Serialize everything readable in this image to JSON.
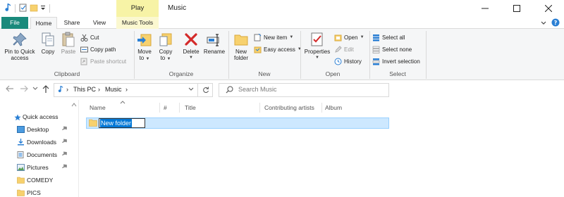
{
  "window": {
    "title": "Music",
    "context_tab_header": "Play"
  },
  "tabs": {
    "file": "File",
    "home": "Home",
    "share": "Share",
    "view": "View",
    "music_tools": "Music Tools"
  },
  "ribbon": {
    "clipboard": {
      "label": "Clipboard",
      "pin_to_quick_access_l1": "Pin to Quick",
      "pin_to_quick_access_l2": "access",
      "copy": "Copy",
      "paste": "Paste",
      "cut": "Cut",
      "copy_path": "Copy path",
      "paste_shortcut": "Paste shortcut"
    },
    "organize": {
      "label": "Organize",
      "move_to_l1": "Move",
      "move_to_l2": "to",
      "copy_to_l1": "Copy",
      "copy_to_l2": "to",
      "delete": "Delete",
      "rename": "Rename"
    },
    "new": {
      "label": "New",
      "new_folder_l1": "New",
      "new_folder_l2": "folder",
      "new_item": "New item",
      "easy_access": "Easy access"
    },
    "open": {
      "label": "Open",
      "properties": "Properties",
      "open": "Open",
      "edit": "Edit",
      "history": "History"
    },
    "select": {
      "label": "Select",
      "select_all": "Select all",
      "select_none": "Select none",
      "invert_selection": "Invert selection"
    }
  },
  "address": {
    "crumbs": [
      "This PC",
      "Music"
    ],
    "search_placeholder": "Search Music"
  },
  "nav_pane": {
    "items": [
      {
        "label": "Quick access",
        "icon": "star-icon"
      },
      {
        "label": "Desktop",
        "icon": "desktop-folder-icon"
      },
      {
        "label": "Downloads",
        "icon": "downloads-folder-icon"
      },
      {
        "label": "Documents",
        "icon": "documents-folder-icon"
      },
      {
        "label": "Pictures",
        "icon": "pictures-folder-icon"
      },
      {
        "label": "COMEDY",
        "icon": "folder-icon"
      },
      {
        "label": "PICS",
        "icon": "folder-icon"
      }
    ]
  },
  "columns": [
    "Name",
    "#",
    "Title",
    "Contributing artists",
    "Album"
  ],
  "files": [
    {
      "name": "New folder",
      "state": "renaming"
    }
  ],
  "colors": {
    "file_tab": "#1a8a7c",
    "context_band": "#f7f3a6",
    "selection": "#cde8ff",
    "rename_highlight": "#0078d7"
  }
}
